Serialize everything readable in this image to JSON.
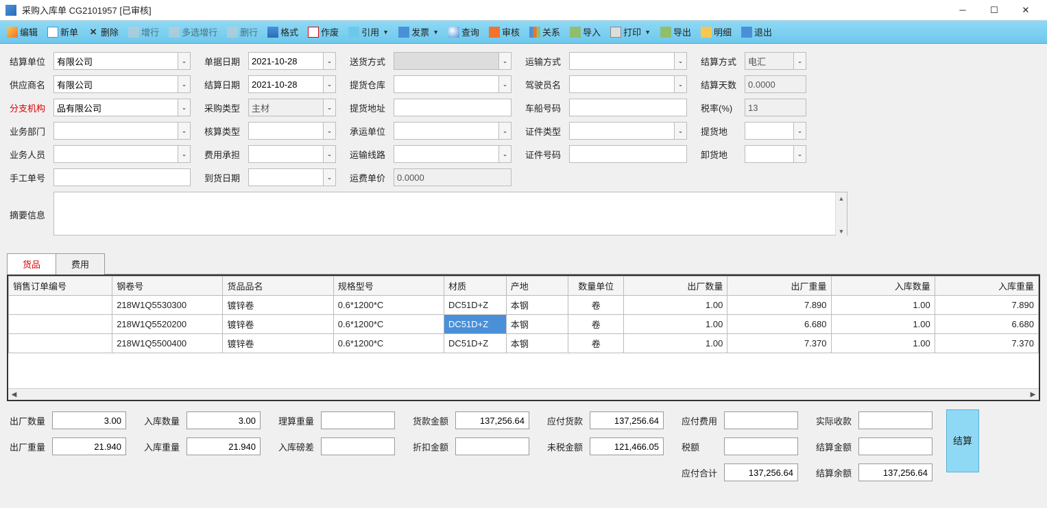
{
  "window": {
    "title": "采购入库单 CG2101957  [已审核]"
  },
  "toolbar": [
    {
      "id": "edit",
      "label": "编辑",
      "icon": "i-edit"
    },
    {
      "id": "new",
      "label": "新单",
      "icon": "i-new"
    },
    {
      "id": "delete",
      "label": "删除",
      "icon": "i-del"
    },
    {
      "id": "addrow",
      "label": "增行",
      "icon": "i-row",
      "disabled": true
    },
    {
      "id": "multirow",
      "label": "多选增行",
      "icon": "i-rows",
      "disabled": true
    },
    {
      "id": "delrow",
      "label": "删行",
      "icon": "i-delrow",
      "disabled": true
    },
    {
      "id": "format",
      "label": "格式",
      "icon": "i-fmt"
    },
    {
      "id": "void",
      "label": "作废",
      "icon": "i-void"
    },
    {
      "id": "reference",
      "label": "引用",
      "icon": "i-ref",
      "dd": true
    },
    {
      "id": "invoice",
      "label": "发票",
      "icon": "i-inv",
      "dd": true
    },
    {
      "id": "query",
      "label": "查询",
      "icon": "i-search"
    },
    {
      "id": "audit",
      "label": "审核",
      "icon": "i-audit"
    },
    {
      "id": "relation",
      "label": "关系",
      "icon": "i-rel"
    },
    {
      "id": "import",
      "label": "导入",
      "icon": "i-imp"
    },
    {
      "id": "print",
      "label": "打印",
      "icon": "i-prn",
      "dd": true
    },
    {
      "id": "export",
      "label": "导出",
      "icon": "i-exp"
    },
    {
      "id": "detail",
      "label": "明细",
      "icon": "i-star"
    },
    {
      "id": "exit",
      "label": "退出",
      "icon": "i-exit"
    }
  ],
  "form": {
    "settle_unit": {
      "label": "结算单位",
      "value": "有限公司"
    },
    "doc_date": {
      "label": "单据日期",
      "value": "2021-10-28"
    },
    "delivery_method": {
      "label": "送货方式",
      "value": ""
    },
    "transport_method": {
      "label": "运输方式",
      "value": ""
    },
    "settle_method": {
      "label": "结算方式",
      "value": "电汇"
    },
    "supplier": {
      "label": "供应商名",
      "value": "有限公司"
    },
    "settle_date": {
      "label": "结算日期",
      "value": "2021-10-28"
    },
    "pickup_warehouse": {
      "label": "提货仓库",
      "value": ""
    },
    "driver": {
      "label": "驾驶员名",
      "value": ""
    },
    "settle_days": {
      "label": "结算天数",
      "value": "0.0000"
    },
    "branch": {
      "label": "分支机构",
      "value": "品有限公司"
    },
    "purchase_type": {
      "label": "采购类型",
      "value": "主材"
    },
    "pickup_addr": {
      "label": "提货地址",
      "value": ""
    },
    "vehicle_no": {
      "label": "车船号码",
      "value": ""
    },
    "tax_rate": {
      "label": "税率(%)",
      "value": "13"
    },
    "dept": {
      "label": "业务部门",
      "value": ""
    },
    "account_type": {
      "label": "核算类型",
      "value": ""
    },
    "carrier": {
      "label": "承运单位",
      "value": ""
    },
    "cert_type": {
      "label": "证件类型",
      "value": ""
    },
    "pickup_loc": {
      "label": "提货地",
      "value": ""
    },
    "staff": {
      "label": "业务人员",
      "value": ""
    },
    "cost_bearer": {
      "label": "费用承担",
      "value": ""
    },
    "route": {
      "label": "运输线路",
      "value": ""
    },
    "cert_no": {
      "label": "证件号码",
      "value": ""
    },
    "unload_loc": {
      "label": "卸货地",
      "value": ""
    },
    "manual_no": {
      "label": "手工单号",
      "value": ""
    },
    "arrive_date": {
      "label": "到货日期",
      "value": ""
    },
    "freight_price": {
      "label": "运费单价",
      "value": "0.0000"
    },
    "summary": {
      "label": "摘要信息",
      "value": ""
    }
  },
  "tabs": [
    {
      "id": "goods",
      "label": "货品",
      "active": true
    },
    {
      "id": "fee",
      "label": "费用",
      "active": false
    }
  ],
  "table": {
    "columns": [
      "销售订单编号",
      "钢卷号",
      "货品品名",
      "规格型号",
      "材质",
      "产地",
      "数量单位",
      "出厂数量",
      "出厂重量",
      "入库数量",
      "入库重量"
    ],
    "rows": [
      {
        "order": "",
        "coil": "218W1Q5530300",
        "name": "镀锌卷",
        "spec": "0.6*1200*C",
        "material": "DC51D+Z",
        "origin": "本钢",
        "unit": "卷",
        "fqty": "1.00",
        "fwt": "7.890",
        "iqty": "1.00",
        "iwt": "7.890"
      },
      {
        "order": "",
        "coil": "218W1Q5520200",
        "name": "镀锌卷",
        "spec": "0.6*1200*C",
        "material": "DC51D+Z",
        "origin": "本钢",
        "unit": "卷",
        "fqty": "1.00",
        "fwt": "6.680",
        "iqty": "1.00",
        "iwt": "6.680",
        "selected_col": "material"
      },
      {
        "order": "",
        "coil": "218W1Q5500400",
        "name": "镀锌卷",
        "spec": "0.6*1200*C",
        "material": "DC51D+Z",
        "origin": "本钢",
        "unit": "卷",
        "fqty": "1.00",
        "fwt": "7.370",
        "iqty": "1.00",
        "iwt": "7.370"
      }
    ]
  },
  "totals": {
    "out_qty": {
      "label": "出厂数量",
      "value": "3.00"
    },
    "in_qty": {
      "label": "入库数量",
      "value": "3.00"
    },
    "theory_wt": {
      "label": "理算重量",
      "value": ""
    },
    "goods_amt": {
      "label": "货款金额",
      "value": "137,256.64"
    },
    "payable_goods": {
      "label": "应付货款",
      "value": "137,256.64"
    },
    "payable_fee": {
      "label": "应付费用",
      "value": ""
    },
    "actual_rcv": {
      "label": "实际收款",
      "value": ""
    },
    "out_wt": {
      "label": "出厂重量",
      "value": "21.940"
    },
    "in_wt": {
      "label": "入库重量",
      "value": "21.940"
    },
    "in_diff": {
      "label": "入库磅差",
      "value": ""
    },
    "discount": {
      "label": "折扣金额",
      "value": ""
    },
    "untaxed": {
      "label": "未税金额",
      "value": "121,466.05"
    },
    "tax_amt": {
      "label": "税额",
      "value": ""
    },
    "settle_amt": {
      "label": "结算金额",
      "value": ""
    },
    "payable_total": {
      "label": "应付合计",
      "value": "137,256.64"
    },
    "settle_balance": {
      "label": "结算余额",
      "value": "137,256.64"
    },
    "settle_btn": "结算"
  }
}
